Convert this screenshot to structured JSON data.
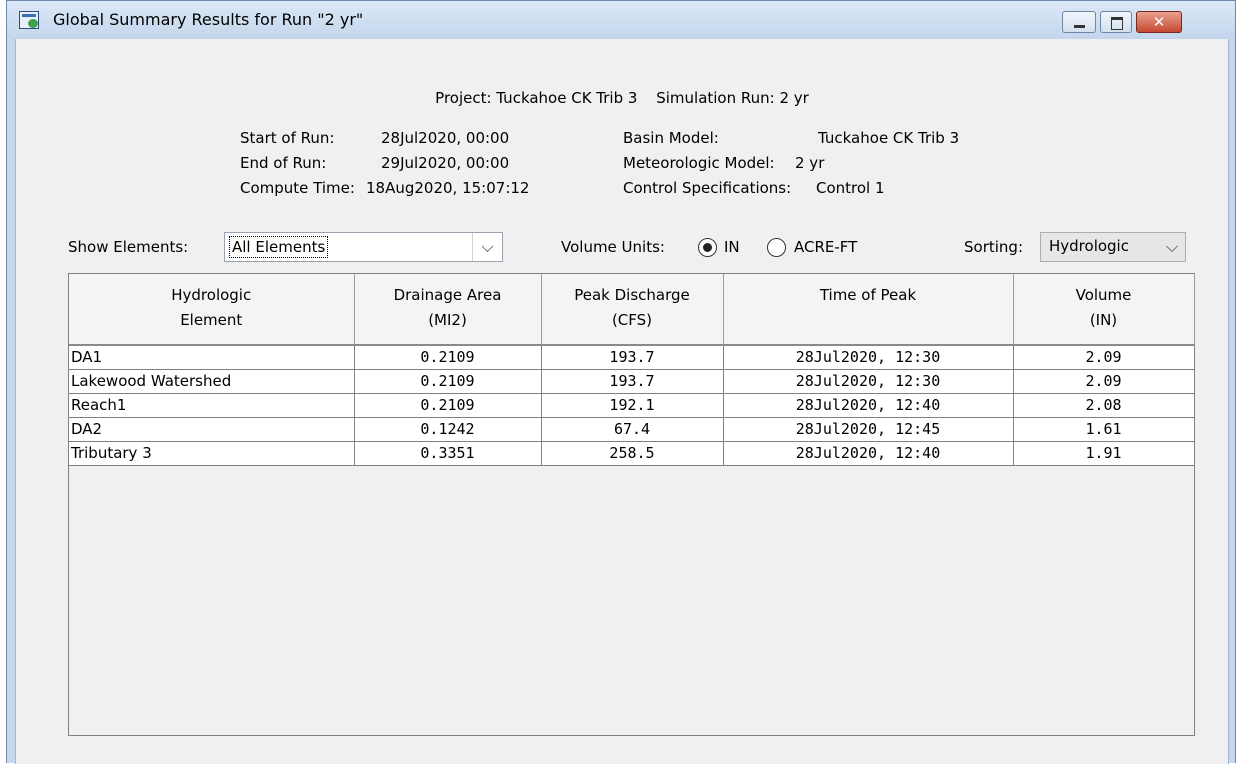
{
  "window": {
    "title": "Global Summary Results for Run \"2 yr\""
  },
  "header": {
    "project": "Project: Tuckahoe CK Trib 3",
    "simulation_run": "Simulation Run: 2 yr"
  },
  "info": {
    "start_label": "Start of Run:",
    "start_value": "28Jul2020, 00:00",
    "end_label": "End of Run:",
    "end_value": "29Jul2020, 00:00",
    "compute_label": "Compute Time:",
    "compute_value": "18Aug2020, 15:07:12",
    "basin_label": "Basin Model:",
    "basin_value": "Tuckahoe CK Trib 3",
    "met_label": "Meteorologic Model:",
    "met_value": "2 yr",
    "control_label": "Control Specifications:",
    "control_value": "Control 1"
  },
  "controls": {
    "show_label": "Show Elements:",
    "show_value": "All Elements",
    "volume_label": "Volume Units:",
    "opt_in": "IN",
    "opt_acre": "ACRE-FT",
    "volume_selected": "IN",
    "sorting_label": "Sorting:",
    "sorting_value": "Hydrologic"
  },
  "table": {
    "headers": [
      {
        "line1": "Hydrologic",
        "line2": "Element"
      },
      {
        "line1": "Drainage Area",
        "line2": "(MI2)"
      },
      {
        "line1": "Peak Discharge",
        "line2": "(CFS)"
      },
      {
        "line1": "Time of Peak",
        "line2": ""
      },
      {
        "line1": "Volume",
        "line2": "(IN)"
      }
    ],
    "rows": [
      {
        "element": "DA1",
        "area": "0.2109",
        "peak": "193.7",
        "time": "28Jul2020, 12:30",
        "volume": "2.09"
      },
      {
        "element": "Lakewood Watershed",
        "area": "0.2109",
        "peak": "193.7",
        "time": "28Jul2020, 12:30",
        "volume": "2.09"
      },
      {
        "element": "Reach1",
        "area": "0.2109",
        "peak": "192.1",
        "time": "28Jul2020, 12:40",
        "volume": "2.08"
      },
      {
        "element": "DA2",
        "area": "0.1242",
        "peak": "67.4",
        "time": "28Jul2020, 12:45",
        "volume": "1.61"
      },
      {
        "element": "Tributary 3",
        "area": "0.3351",
        "peak": "258.5",
        "time": "28Jul2020, 12:40",
        "volume": "1.91"
      }
    ]
  }
}
